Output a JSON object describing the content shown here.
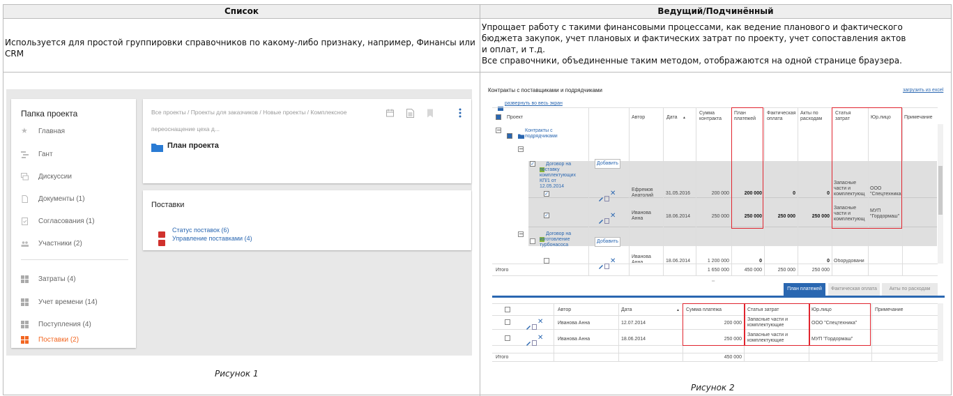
{
  "table": {
    "col1_header": "Список",
    "col2_header": "Ведущий/Подчинённый",
    "col1_desc": "Используется для простой группировки справочников по какому-либо признаку, например, Финансы или CRM",
    "col2_desc_lines": [
      "Упрощает работу с такими финансовыми процессами, как ведение планового и фактического",
      "бюджета закупок, учет плановых и фактических затрат по проекту, учет сопоставления актов",
      "и оплат, и т.д.",
      "Все справочники, объединенные таким методом, отображаются на одной странице браузера."
    ],
    "caption1": "Рисунок 1",
    "caption2": "Рисунок 2"
  },
  "fig1": {
    "sidebar_title": "Папка проекта",
    "sidebar_items": [
      {
        "label": "Главная",
        "icon": "star-icon"
      },
      {
        "label": "Гант",
        "icon": "gantt-icon"
      },
      {
        "label": "Дискуссии",
        "icon": "chat-icon"
      },
      {
        "label": "Документы (1)",
        "icon": "document-icon"
      },
      {
        "label": "Согласования (1)",
        "icon": "approval-icon"
      },
      {
        "label": "Участники (2)",
        "icon": "people-icon"
      }
    ],
    "sidebar_items2": [
      {
        "label": "Затраты (4)",
        "active": false
      },
      {
        "label": "Учет времени (14)",
        "active": false
      },
      {
        "label": "Поступления (4)",
        "active": false
      },
      {
        "label": "Поставки (2)",
        "active": true
      }
    ],
    "breadcrumb_line1": "Все проекты / Проекты для заказчиков / Новые проекты / Комплексное",
    "breadcrumb_line2": "переоснащение цеха д...",
    "plan_title": "План проекта",
    "supply_title": "Поставки",
    "supply_links": [
      "Статус поставок (6)",
      "Управление поставками (4)"
    ],
    "colors": {
      "accent": "#f26722",
      "folder": "#2a7bd4",
      "cube": "#d0312d"
    }
  },
  "fig2": {
    "title": "Контракты с поставщиками и подрядчиками",
    "export_link": "загрузить из excel",
    "expand_link": "развернуть во весь экран",
    "headers": [
      "Проект",
      "Автор",
      "Дата",
      "Сумма контракта",
      "План платежей",
      "Фактическая оплата",
      "Акты по расходам",
      "Статья затрат",
      "Юр.лицо",
      "Примечание"
    ],
    "group1": "Контракты с подрядчиками",
    "contract1": "Договор на поставку комплектующих КП/1 от 12.05.2014",
    "contract2": "Договор на изготовление турбонасоса",
    "add_btn": "Добавить",
    "rows": [
      {
        "author": "Ефремов Анатолий",
        "date": "31.05.2016",
        "sum": "200 000",
        "plan": "200 000",
        "fact": "0",
        "acts": "0",
        "article": "Запасные части и комплектующ",
        "entity": "ООО \"Спецтехника"
      },
      {
        "author": "Иванова Анна",
        "date": "18.06.2014",
        "sum": "250 000",
        "plan": "250 000",
        "fact": "250 000",
        "acts": "250 000",
        "article": "Запасные части и комплектующ",
        "entity": "МУП \"Гордормаш\""
      },
      {
        "author": "Иванова Анна",
        "date": "18.06.2014",
        "sum": "1 200 000",
        "plan": "0",
        "fact": "",
        "acts": "0",
        "article": "Оборудовани",
        "entity": ""
      }
    ],
    "total_label": "Итого",
    "totals": [
      "1 650 000",
      "450 000",
      "250 000",
      "250 000"
    ],
    "tabs": [
      "План платежей",
      "Фактическая оплата",
      "Акты по расходам"
    ],
    "sub_headers": [
      "Автор",
      "Дата",
      "Сумма платежа",
      "Статья затрат",
      "Юр.лицо",
      "Примечание"
    ],
    "sub_rows": [
      {
        "author": "Иванова Анна",
        "date": "12.07.2014",
        "sum": "200 000",
        "article": "Запасные части и комплектующие",
        "entity": "ООО \"Спецтехника\""
      },
      {
        "author": "Иванова Анна",
        "date": "18.06.2014",
        "sum": "250 000",
        "article": "Запасные части и комплектующие",
        "entity": "МУП \"Гордормаш\""
      }
    ],
    "sub_total_label": "Итого",
    "sub_total": "450 000",
    "colors": {
      "link": "#2a67b1",
      "highlight": "#e0242e",
      "tab_active": "#2a67b1"
    }
  }
}
